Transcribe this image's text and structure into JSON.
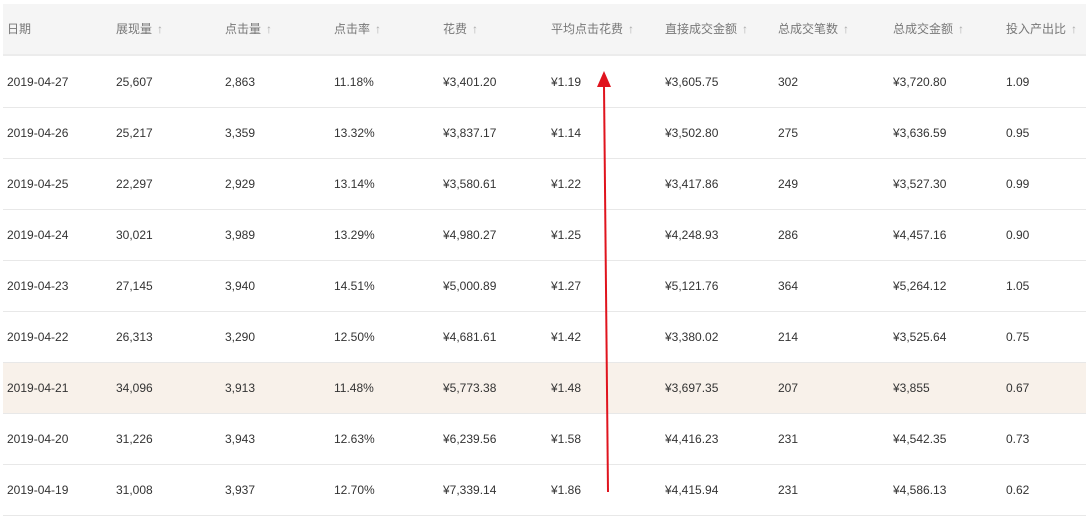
{
  "columns": [
    {
      "label": "日期",
      "sortable": false
    },
    {
      "label": "展现量",
      "sortable": true
    },
    {
      "label": "点击量",
      "sortable": true
    },
    {
      "label": "点击率",
      "sortable": true
    },
    {
      "label": "花费",
      "sortable": true
    },
    {
      "label": "平均点击花费",
      "sortable": true
    },
    {
      "label": "直接成交金额",
      "sortable": true
    },
    {
      "label": "总成交笔数",
      "sortable": true
    },
    {
      "label": "总成交金额",
      "sortable": true
    },
    {
      "label": "投入产出比",
      "sortable": true
    }
  ],
  "sort_icon": "↑",
  "rows": [
    [
      "2019-04-27",
      "25,607",
      "2,863",
      "11.18%",
      "¥3,401.20",
      "¥1.19",
      "¥3,605.75",
      "302",
      "¥3,720.80",
      "1.09"
    ],
    [
      "2019-04-26",
      "25,217",
      "3,359",
      "13.32%",
      "¥3,837.17",
      "¥1.14",
      "¥3,502.80",
      "275",
      "¥3,636.59",
      "0.95"
    ],
    [
      "2019-04-25",
      "22,297",
      "2,929",
      "13.14%",
      "¥3,580.61",
      "¥1.22",
      "¥3,417.86",
      "249",
      "¥3,527.30",
      "0.99"
    ],
    [
      "2019-04-24",
      "30,021",
      "3,989",
      "13.29%",
      "¥4,980.27",
      "¥1.25",
      "¥4,248.93",
      "286",
      "¥4,457.16",
      "0.90"
    ],
    [
      "2019-04-23",
      "27,145",
      "3,940",
      "14.51%",
      "¥5,000.89",
      "¥1.27",
      "¥5,121.76",
      "364",
      "¥5,264.12",
      "1.05"
    ],
    [
      "2019-04-22",
      "26,313",
      "3,290",
      "12.50%",
      "¥4,681.61",
      "¥1.42",
      "¥3,380.02",
      "214",
      "¥3,525.64",
      "0.75"
    ],
    [
      "2019-04-21",
      "34,096",
      "3,913",
      "11.48%",
      "¥5,773.38",
      "¥1.48",
      "¥3,697.35",
      "207",
      "¥3,855",
      "0.67"
    ],
    [
      "2019-04-20",
      "31,226",
      "3,943",
      "12.63%",
      "¥6,239.56",
      "¥1.58",
      "¥4,416.23",
      "231",
      "¥4,542.35",
      "0.73"
    ],
    [
      "2019-04-19",
      "31,008",
      "3,937",
      "12.70%",
      "¥7,339.14",
      "¥1.86",
      "¥4,415.94",
      "231",
      "¥4,586.13",
      "0.62"
    ]
  ],
  "highlighted_row": 6,
  "annotation_color": "#e0141e"
}
